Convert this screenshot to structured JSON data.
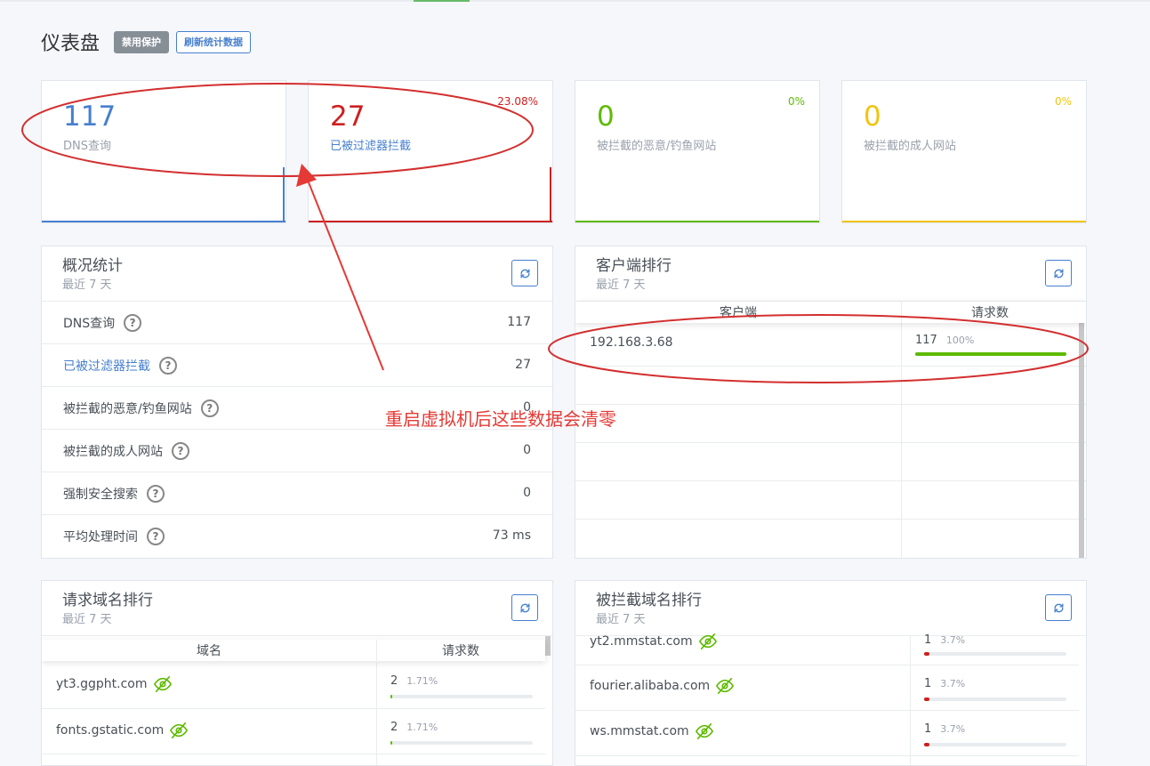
{
  "page": {
    "title": "仪表盘",
    "btn_disable": "禁用保护",
    "btn_refresh": "刷新统计数据"
  },
  "stats": [
    {
      "value": "117",
      "label": "DNS查询",
      "pct": "",
      "color": "#467fcf"
    },
    {
      "value": "27",
      "label": "已被过滤器拦截",
      "pct": "23.08%",
      "color": "#cd201f"
    },
    {
      "value": "0",
      "label": "被拦截的恶意/钓鱼网站",
      "pct": "0%",
      "color": "#5eba00"
    },
    {
      "value": "0",
      "label": "被拦截的成人网站",
      "pct": "0%",
      "color": "#f1c40f"
    }
  ],
  "overview": {
    "title": "概况统计",
    "subtitle": "最近 7 天",
    "rows": [
      {
        "label": "DNS查询",
        "value": "117"
      },
      {
        "label": "已被过滤器拦截",
        "value": "27"
      },
      {
        "label": "被拦截的恶意/钓鱼网站",
        "value": "0"
      },
      {
        "label": "被拦截的成人网站",
        "value": "0"
      },
      {
        "label": "强制安全搜索",
        "value": "0"
      },
      {
        "label": "平均处理时间",
        "value": "73 ms"
      }
    ]
  },
  "clients": {
    "title": "客户端排行",
    "subtitle": "最近 7 天",
    "col_client": "客户端",
    "col_requests": "请求数",
    "rows": [
      {
        "client": "192.168.3.68",
        "count": "117",
        "pct": "100%",
        "fraction": 1.0
      }
    ]
  },
  "queried": {
    "title": "请求域名排行",
    "subtitle": "最近 7 天",
    "col_domain": "域名",
    "col_requests": "请求数",
    "rows": [
      {
        "domain": "yt3.ggpht.com",
        "count": "2",
        "pct": "1.71%",
        "fraction": 0.0171
      },
      {
        "domain": "fonts.gstatic.com",
        "count": "2",
        "pct": "1.71%",
        "fraction": 0.0171
      }
    ]
  },
  "blocked": {
    "title": "被拦截域名排行",
    "subtitle": "最近 7 天",
    "rows": [
      {
        "domain": "yt2.mmstat.com",
        "count": "1",
        "pct": "3.7%",
        "fraction": 0.037
      },
      {
        "domain": "fourier.alibaba.com",
        "count": "1",
        "pct": "3.7%",
        "fraction": 0.037
      },
      {
        "domain": "ws.mmstat.com",
        "count": "1",
        "pct": "3.7%",
        "fraction": 0.037
      }
    ]
  },
  "annotation": {
    "text": "重启虚拟机后这些数据会清零"
  },
  "colors": {
    "primary": "#467fcf",
    "danger": "#cd201f",
    "success": "#5eba00",
    "warning": "#f1c40f",
    "annotation": "#e53935"
  }
}
